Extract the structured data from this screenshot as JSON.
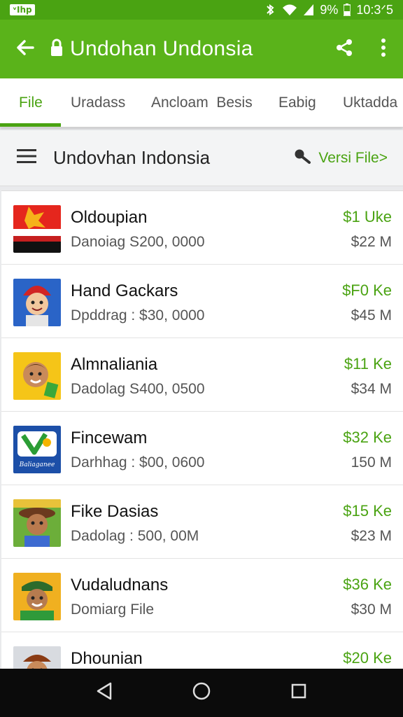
{
  "status_bar": {
    "carrier_badge": "ᵛIhp",
    "battery": "9%",
    "time": "10:3ᐟ5"
  },
  "app_bar": {
    "title": "Undohan Undonsia",
    "icons": [
      "back-arrow-icon",
      "lock-icon",
      "share-icon",
      "more-vert-icon"
    ]
  },
  "tabs": [
    {
      "label": "File",
      "active": true
    },
    {
      "label": "Uradass",
      "active": false
    },
    {
      "label": "Ancloam  Besis",
      "active": false
    },
    {
      "label": "Eabig",
      "active": false
    },
    {
      "label": "Uktadda",
      "active": false
    }
  ],
  "subheader": {
    "title": "Undovhan Indonsia",
    "version_link": "Versi File>"
  },
  "items": [
    {
      "name": "Oldoupian",
      "desc": "Danoiag S200, 0000",
      "price": "$1 Uke",
      "size": "$22 M",
      "thumb": "flag-thumbnail"
    },
    {
      "name": "Hand Gackars",
      "desc": "Dpddrag : $30, 0000",
      "price": "$F0 Ke",
      "size": "$45 M",
      "thumb": "character-thumbnail"
    },
    {
      "name": "Almnaliania",
      "desc": "Dadolag S400, 0500",
      "price": "$11 Ke",
      "size": "$34 M",
      "thumb": "avatar-thumbnail"
    },
    {
      "name": "Fincewam",
      "desc": "Darhhag : $00, 0600",
      "price": "$32 Ke",
      "size": "150 M",
      "thumb": "logo-thumbnail",
      "thumb_text": "Baliaganee"
    },
    {
      "name": "Fike Dasias",
      "desc": "Dadolag : 500, 00M",
      "price": "$15 Ke",
      "size": "$23 M",
      "thumb": "character-thumbnail"
    },
    {
      "name": "Vudaludnans",
      "desc": "Domiarg File",
      "price": "$36 Ke",
      "size": "$30 M",
      "thumb": "character-thumbnail"
    },
    {
      "name": "Dhounian",
      "desc": "",
      "price": "$20 Ke",
      "size": "",
      "thumb": "character-thumbnail"
    }
  ],
  "colors": {
    "accent_green": "#4aa312",
    "appbar_green": "#5ab31a"
  },
  "nav_bar": {
    "icons": [
      "nav-back-icon",
      "nav-home-icon",
      "nav-recents-icon"
    ]
  }
}
